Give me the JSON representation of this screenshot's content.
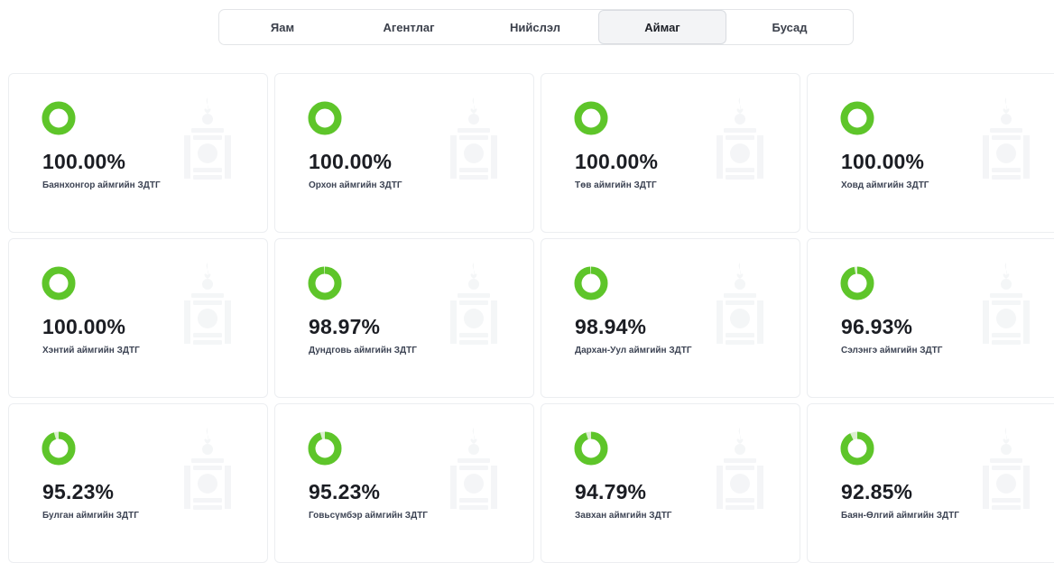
{
  "tabs": [
    {
      "label": "Яам",
      "active": false
    },
    {
      "label": "Агентлаг",
      "active": false
    },
    {
      "label": "Нийслэл",
      "active": false
    },
    {
      "label": "Аймаг",
      "active": true
    },
    {
      "label": "Бусад",
      "active": false
    }
  ],
  "colors": {
    "ring_fill": "#5ec52a",
    "ring_track": "#dcefd0",
    "emblem": "#eceef1"
  },
  "cards": [
    {
      "percent": "100.00%",
      "value": 100.0,
      "label": "Баянхонгор аймгийн ЗДТГ"
    },
    {
      "percent": "100.00%",
      "value": 100.0,
      "label": "Орхон аймгийн ЗДТГ"
    },
    {
      "percent": "100.00%",
      "value": 100.0,
      "label": "Төв аймгийн ЗДТГ"
    },
    {
      "percent": "100.00%",
      "value": 100.0,
      "label": "Ховд аймгийн ЗДТГ"
    },
    {
      "percent": "100.00%",
      "value": 100.0,
      "label": "Хэнтий аймгийн ЗДТГ"
    },
    {
      "percent": "98.97%",
      "value": 98.97,
      "label": "Дундговь аймгийн ЗДТГ"
    },
    {
      "percent": "98.94%",
      "value": 98.94,
      "label": "Дархан-Уул аймгийн ЗДТГ"
    },
    {
      "percent": "96.93%",
      "value": 96.93,
      "label": "Сэлэнгэ аймгийн ЗДТГ"
    },
    {
      "percent": "95.23%",
      "value": 95.23,
      "label": "Булган аймгийн ЗДТГ"
    },
    {
      "percent": "95.23%",
      "value": 95.23,
      "label": "Говьсүмбэр аймгийн ЗДТГ"
    },
    {
      "percent": "94.79%",
      "value": 94.79,
      "label": "Завхан аймгийн ЗДТГ"
    },
    {
      "percent": "92.85%",
      "value": 92.85,
      "label": "Баян-Өлгий аймгийн ЗДТГ"
    }
  ]
}
